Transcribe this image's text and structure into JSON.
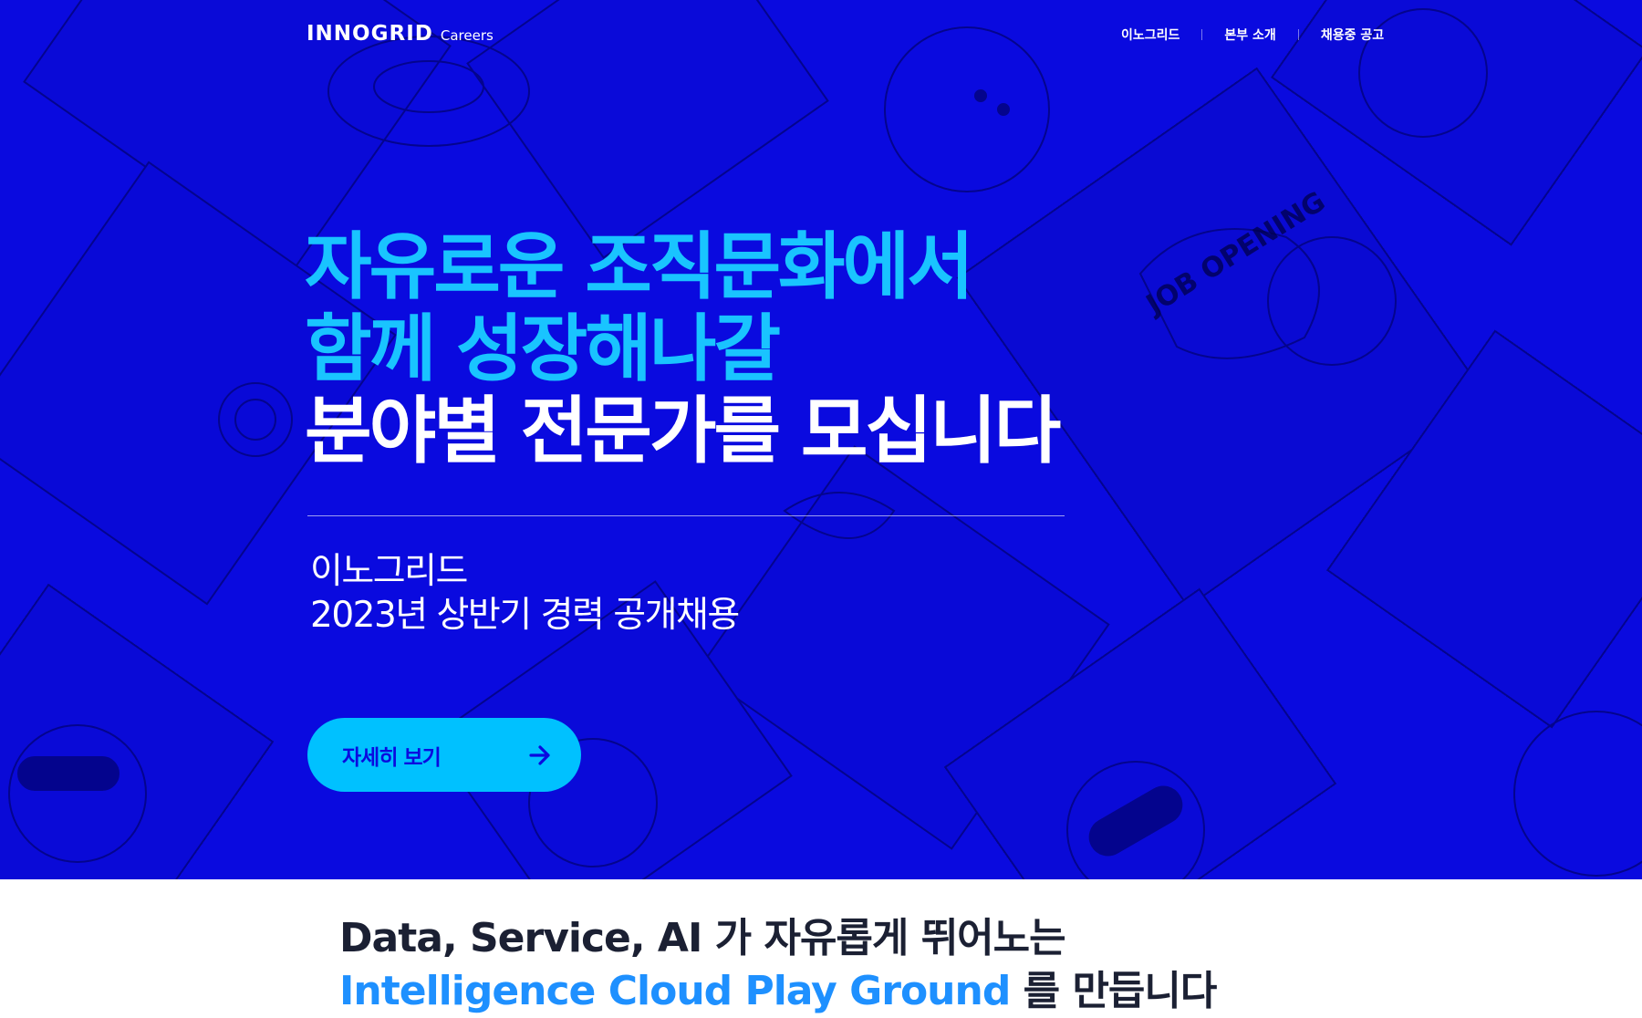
{
  "header": {
    "logo_main": "INNOGRID",
    "logo_sub": "Careers",
    "nav": [
      {
        "label": "이노그리드"
      },
      {
        "label": "본부 소개"
      },
      {
        "label": "채용중 공고"
      }
    ]
  },
  "hero": {
    "headline_line1": "자유로운 조직문화에서",
    "headline_line2": "함께 성장해나갈",
    "headline_line3": "분야별 전문가를 모십니다",
    "sub_line1": "이노그리드",
    "sub_line2": "2023년 상반기 경력 공개채용",
    "cta_label": "자세히 보기",
    "cta_icon": "arrow-right-icon",
    "illustration_text": "JOB OPENING"
  },
  "intro": {
    "line1": "Data, Service, AI 가 자유롭게 뛰어노는",
    "line2_highlight": "Intelligence Cloud Play Ground",
    "line2_rest": " 를 만듭니다"
  },
  "colors": {
    "hero_bg": "#0a0adf",
    "accent_cyan": "#19c4ff",
    "button_bg": "#00c1ff",
    "intro_text": "#1b2033",
    "intro_highlight": "#1e90ff"
  }
}
